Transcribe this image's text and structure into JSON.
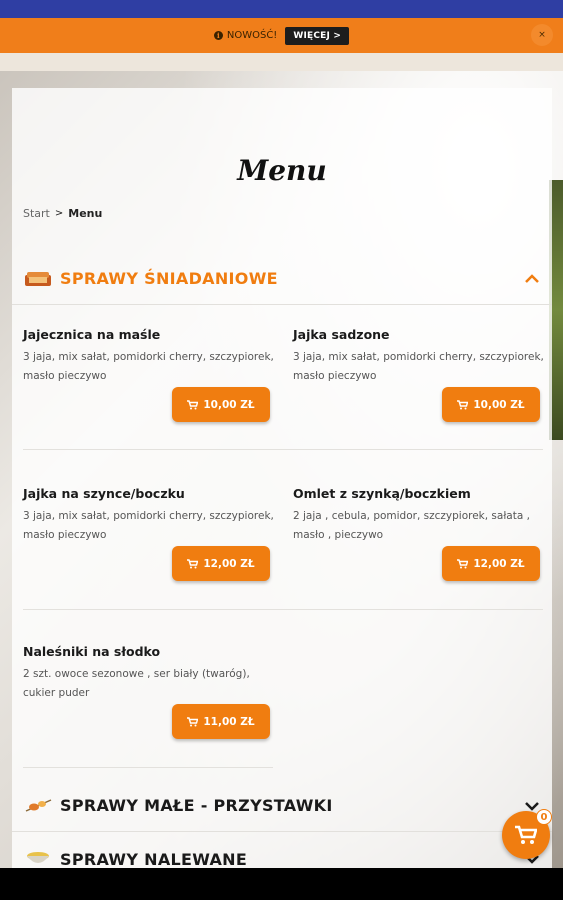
{
  "promo": {
    "text": "NOWOŚĆ!",
    "button": "WIĘCEJ >",
    "close": "×"
  },
  "page": {
    "title": "Menu",
    "breadcrumb": {
      "start": "Start",
      "separator": ">",
      "current": "Menu"
    }
  },
  "sections": [
    {
      "title": "SPRAWY ŚNIADANIOWE",
      "icon": "toast-icon",
      "expanded": true,
      "color": "#f07d10"
    },
    {
      "title": "SPRAWY MAŁE - PRZYSTAWKI",
      "icon": "skewer-icon",
      "expanded": false,
      "color": "#1a1a1a"
    },
    {
      "title": "SPRAWY NALEWANE",
      "icon": "soup-bowl-icon",
      "expanded": false,
      "color": "#1a1a1a"
    }
  ],
  "items": [
    {
      "name": "Jajecznica na maśle",
      "desc": "3 jaja, mix sałat, pomidorki cherry, szczypiorek, masło pieczywo",
      "price": "10,00 ZŁ"
    },
    {
      "name": "Jajka sadzone",
      "desc": "3 jaja, mix sałat, pomidorki cherry, szczypiorek, masło pieczywo",
      "price": "10,00 ZŁ"
    },
    {
      "name": "Jajka na szynce/boczku",
      "desc": "3 jaja, mix sałat, pomidorki cherry, szczypiorek, masło pieczywo",
      "price": "12,00 ZŁ"
    },
    {
      "name": "Omlet z szynką/boczkiem",
      "desc": "2 jaja , cebula, pomidor, szczypiorek, sałata , masło , pieczywo",
      "price": "12,00 ZŁ"
    },
    {
      "name": "Naleśniki na słodko",
      "desc": "2 szt. owoce sezonowe , ser biały (twaróg), cukier puder",
      "price": "11,00 ZŁ"
    }
  ],
  "cart": {
    "count": "0"
  },
  "colors": {
    "accent": "#f07d10",
    "statusbar": "#2f3ea3",
    "promo": "#f07e1a"
  }
}
